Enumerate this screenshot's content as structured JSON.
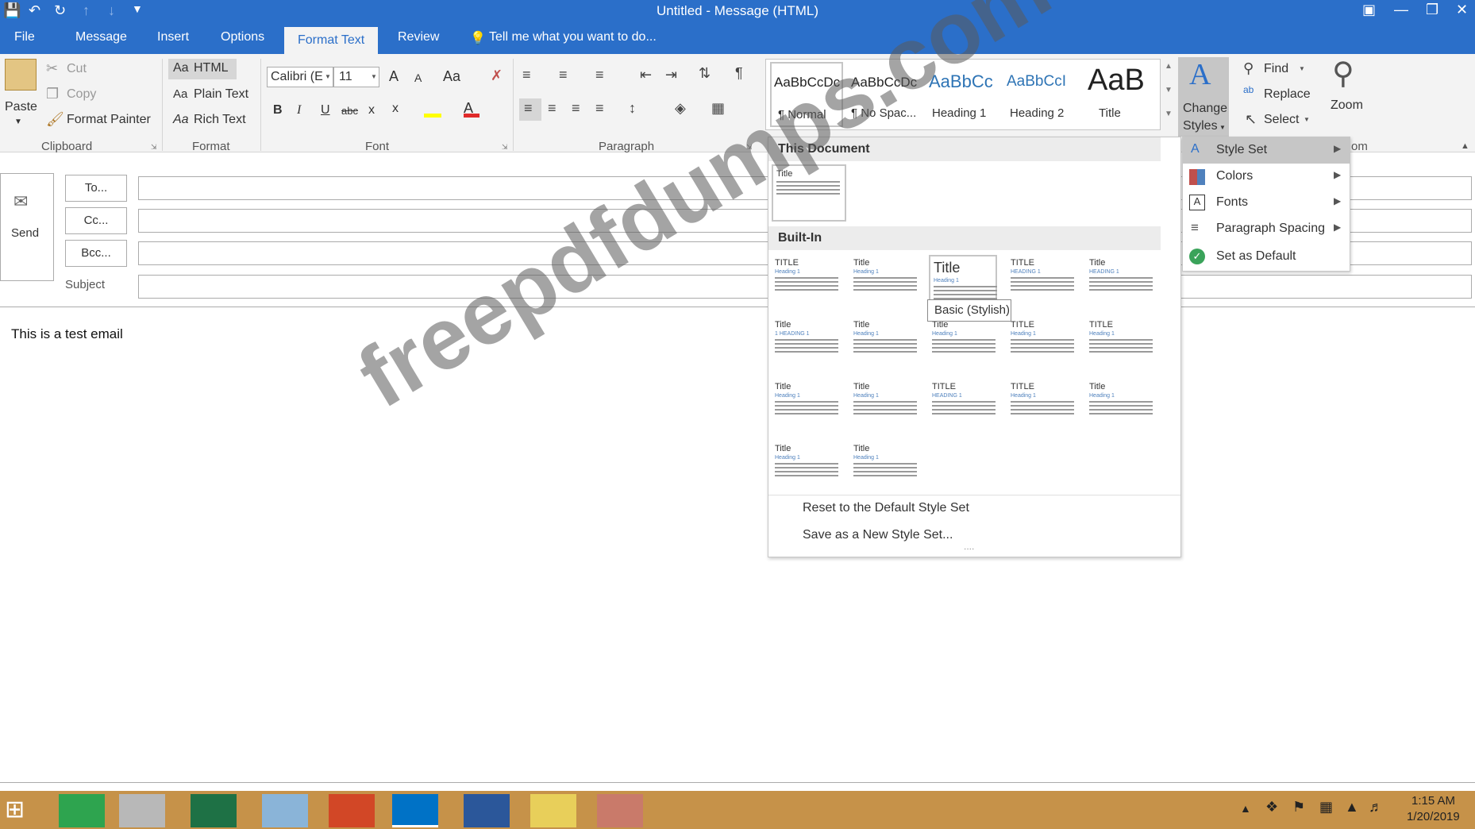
{
  "window": {
    "title": "Untitled - Message (HTML)"
  },
  "tabs": [
    "File",
    "Message",
    "Insert",
    "Options",
    "Format Text",
    "Review"
  ],
  "active_tab": "Format Text",
  "tell_me": "Tell me what you want to do...",
  "clipboard": {
    "paste": "Paste",
    "cut": "Cut",
    "copy": "Copy",
    "format_painter": "Format Painter",
    "group": "Clipboard"
  },
  "format": {
    "html": "HTML",
    "plain": "Plain Text",
    "rich": "Rich Text",
    "group": "Format",
    "aa": "Aa"
  },
  "font": {
    "name": "Calibri (E",
    "size": "11",
    "group": "Font",
    "grow": "A",
    "shrink": "A",
    "case": "Aa",
    "bold": "B",
    "italic": "I",
    "underline": "U",
    "strike": "abc",
    "sub": "x",
    "sup": "x"
  },
  "paragraph": {
    "group": "Paragraph"
  },
  "styles": [
    {
      "preview": "AaBbCcDc",
      "label": "¶ Normal"
    },
    {
      "preview": "AaBbCcDc",
      "label": "¶ No Spac..."
    },
    {
      "preview": "AaBbCc",
      "label": "Heading 1"
    },
    {
      "preview": "AaBbCcI",
      "label": "Heading 2"
    },
    {
      "preview": "AaB",
      "label": "Title"
    }
  ],
  "change_styles": {
    "line1": "Change",
    "line2": "Styles"
  },
  "editing": {
    "find": "Find",
    "replace": "Replace",
    "select": "Select",
    "zoom": "Zoom",
    "zoom_group_partial": "om"
  },
  "compose": {
    "send": "Send",
    "to": "To...",
    "cc": "Cc...",
    "bcc": "Bcc...",
    "subject": "Subject",
    "body": "This is a test email"
  },
  "gallery": {
    "this_document": "This Document",
    "built_in": "Built-In",
    "tooltip": "Basic (Stylish)",
    "reset": "Reset to the Default Style Set",
    "save": "Save as a New Style Set...",
    "doc_thumb_title": "Title",
    "thumbs": [
      {
        "title": "TITLE",
        "heading": "Heading 1"
      },
      {
        "title": "Title",
        "heading": "Heading 1"
      },
      {
        "title": "Title",
        "heading": "Heading 1"
      },
      {
        "title": "TITLE",
        "heading": "HEADING 1"
      },
      {
        "title": "Title",
        "heading": "HEADING 1"
      },
      {
        "title": "Title",
        "heading": "1 HEADING 1"
      },
      {
        "title": "Title",
        "heading": "Heading 1"
      },
      {
        "title": "Title",
        "heading": "Heading 1"
      },
      {
        "title": "TITLE",
        "heading": "Heading 1"
      },
      {
        "title": "TITLE",
        "heading": "Heading 1"
      },
      {
        "title": "Title",
        "heading": "Heading 1"
      },
      {
        "title": "Title",
        "heading": "Heading 1"
      },
      {
        "title": "TITLE",
        "heading": "HEADING 1"
      },
      {
        "title": "TITLE",
        "heading": "Heading 1"
      },
      {
        "title": "Title",
        "heading": "Heading 1"
      },
      {
        "title": "Title",
        "heading": "Heading 1"
      },
      {
        "title": "Title",
        "heading": "Heading 1"
      }
    ]
  },
  "submenu": [
    "Style Set",
    "Colors",
    "Fonts",
    "Paragraph Spacing",
    "Set as Default"
  ],
  "taskbar": {
    "time": "1:15 AM",
    "date": "1/20/2019"
  },
  "watermark": "freepdfdumps.com",
  "colors": {
    "accent": "#2b6fc9",
    "taskbar": "#c69249"
  }
}
